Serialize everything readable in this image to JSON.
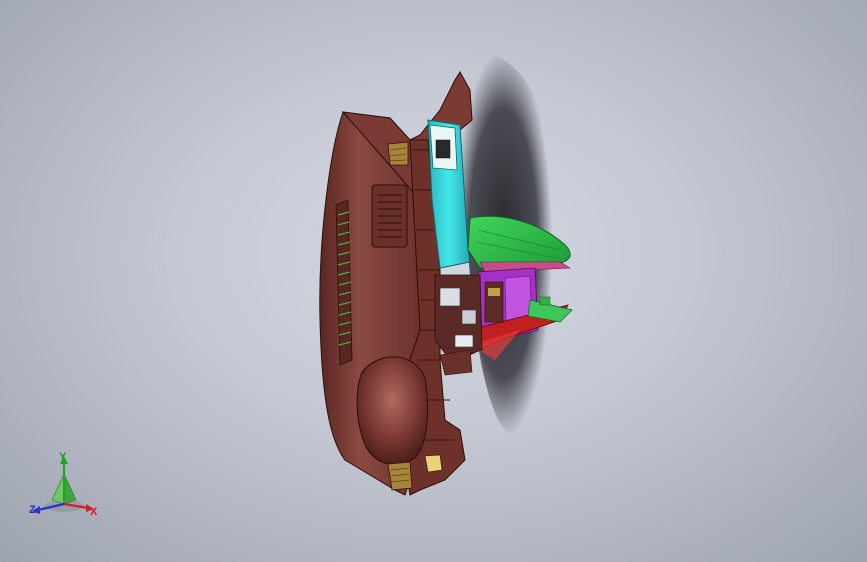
{
  "viewport": {
    "background_top": "#d4d8e2",
    "background_edge": "#9ea3b0"
  },
  "model": {
    "description_colors": {
      "body": "#7a3a34",
      "body_dark": "#4a1e1a",
      "duct": "#35d9d9",
      "tray": "#2fbf4a",
      "bracket": "#a531c6",
      "red_part": "#c02020",
      "vent": "#9c7a2e",
      "shadow": "#2a2a30"
    }
  },
  "triad": {
    "x_label": "X",
    "y_label": "Y",
    "z_label": "Z",
    "x_color": "#d0202a",
    "y_color": "#1ea51e",
    "z_color": "#2533c8"
  }
}
